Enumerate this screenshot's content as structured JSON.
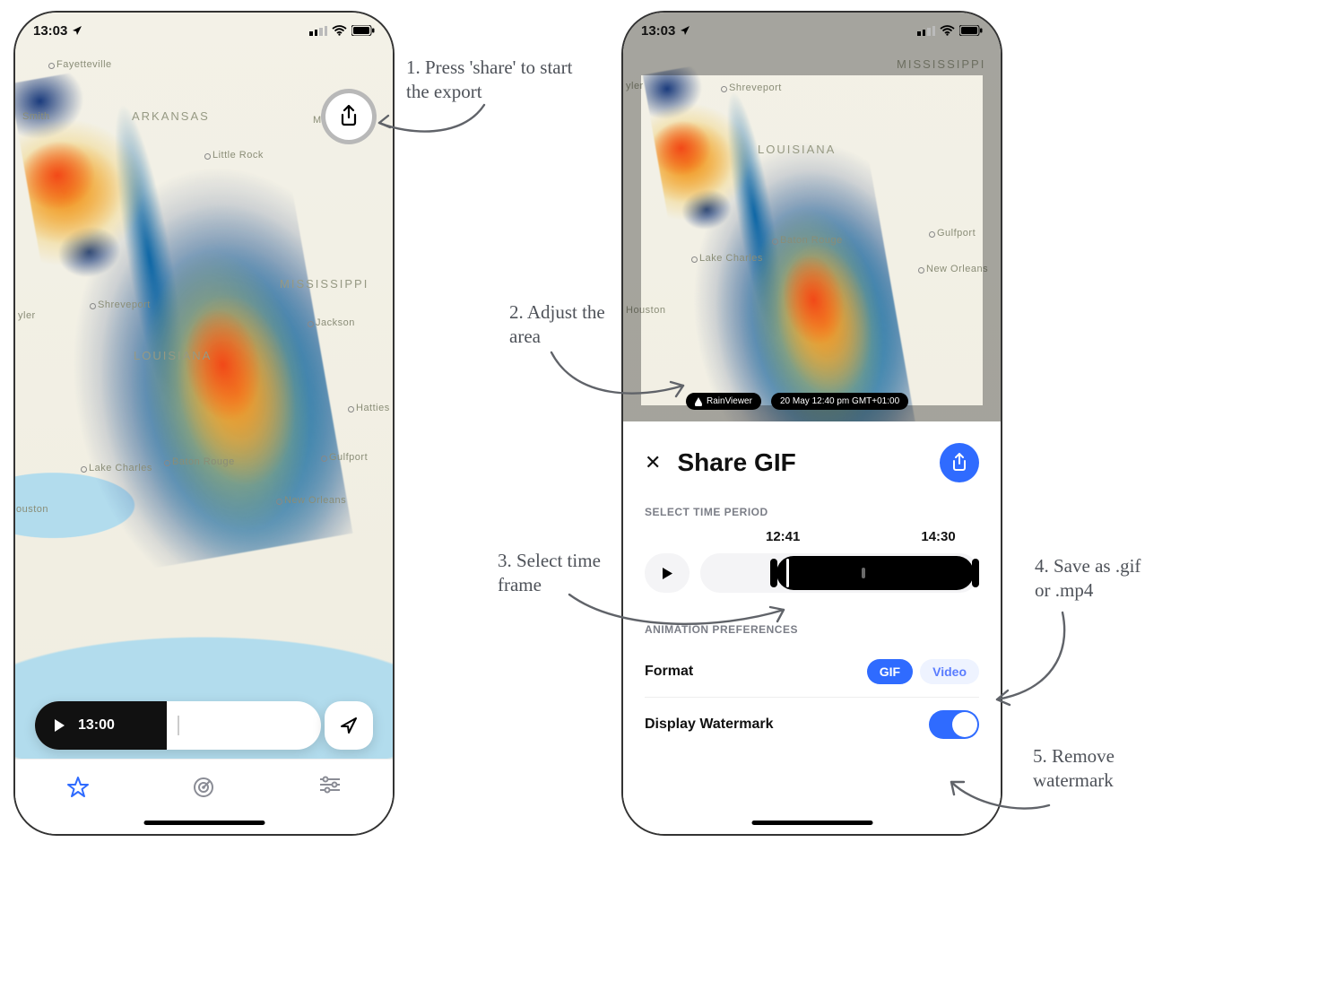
{
  "status": {
    "time": "13:03"
  },
  "phone1": {
    "timeline_time": "13:00",
    "map_labels": {
      "arkansas": "ARKANSAS",
      "mississippi": "MISSISSIPPI",
      "louisiana": "LOUISIANA",
      "fayetteville": "Fayetteville",
      "little_rock": "Little Rock",
      "smith": "Smith",
      "me": "Me",
      "jackson": "Jackson",
      "hatties": "Hatties",
      "shreveport": "Shreveport",
      "baton_rouge": "Baton Rouge",
      "lake_charles": "Lake Charles",
      "new_orleans": "New Orleans",
      "gulfport": "Gulfport",
      "houston": "ouston",
      "yler": "yler"
    }
  },
  "phone2": {
    "overlay_labels": {
      "mississippi": "MISSISSIPPI",
      "louisiana": "LOUISIANA",
      "shreveport": "Shreveport",
      "baton_rouge": "Baton Rouge",
      "lake_charles": "Lake Charles",
      "new_orleans": "New Orleans",
      "gulfport": "Gulfport",
      "houston": "Houston",
      "yler": "yler"
    },
    "brand": "RainViewer",
    "timestamp": "20 May 12:40 pm GMT+01:00",
    "sheet": {
      "title": "Share GIF",
      "section_time": "SELECT TIME PERIOD",
      "t_start": "12:41",
      "t_end": "14:30",
      "section_pref": "ANIMATION PREFERENCES",
      "format_label": "Format",
      "format_gif": "GIF",
      "format_video": "Video",
      "watermark_label": "Display Watermark"
    }
  },
  "annotations": {
    "a1": "1. Press 'share' to start the export",
    "a2": "2. Adjust the area",
    "a3": "3. Select time frame",
    "a4": "4. Save as .gif or .mp4",
    "a5": "5. Remove watermark"
  }
}
